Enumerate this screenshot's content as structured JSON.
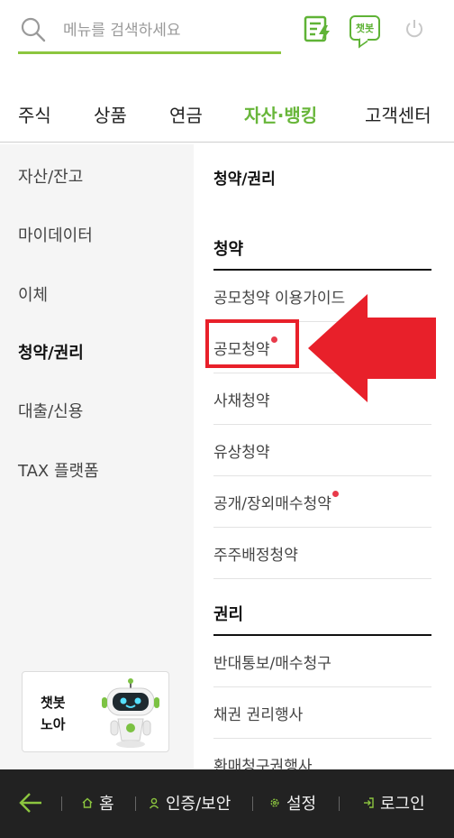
{
  "search": {
    "placeholder": "메뉴를 검색하세요"
  },
  "header": {
    "chatbot_badge": "챗봇",
    "icons": [
      "quick-menu-icon",
      "chatbot-icon",
      "power-icon"
    ]
  },
  "nav": {
    "tabs": [
      {
        "label": "주식"
      },
      {
        "label": "상품"
      },
      {
        "label": "연금"
      },
      {
        "label": "자산·뱅킹",
        "active": true
      },
      {
        "label": "고객센터"
      }
    ]
  },
  "side_menu": {
    "items": [
      {
        "label": "자산/잔고"
      },
      {
        "label": "마이데이터"
      },
      {
        "label": "이체"
      },
      {
        "label": "청약/권리",
        "active": true
      },
      {
        "label": "대출/신용"
      },
      {
        "label": "TAX 플랫폼"
      }
    ]
  },
  "content": {
    "title": "청약/권리",
    "sections": [
      {
        "heading": "청약",
        "items": [
          {
            "label": "공모청약 이용가이드"
          },
          {
            "label": "공모청약",
            "new": true,
            "highlighted": true
          },
          {
            "label": "사채청약"
          },
          {
            "label": "유상청약"
          },
          {
            "label": "공개/장외매수청약",
            "new": true
          },
          {
            "label": "주주배정청약"
          }
        ]
      },
      {
        "heading": "권리",
        "items": [
          {
            "label": "반대통보/매수청구"
          },
          {
            "label": "채권 권리행사"
          },
          {
            "label": "환매청구권행사"
          }
        ]
      }
    ]
  },
  "chatbot_card": {
    "line1": "챗봇",
    "line2": "노아"
  },
  "bottom_bar": {
    "home": "홈",
    "auth": "인증/보안",
    "settings": "설정",
    "login": "로그인"
  },
  "colors": {
    "accent": "#68b63a",
    "highlight": "#e8202a",
    "new_dot": "#e83a4a",
    "bottom_bar": "#222222"
  }
}
